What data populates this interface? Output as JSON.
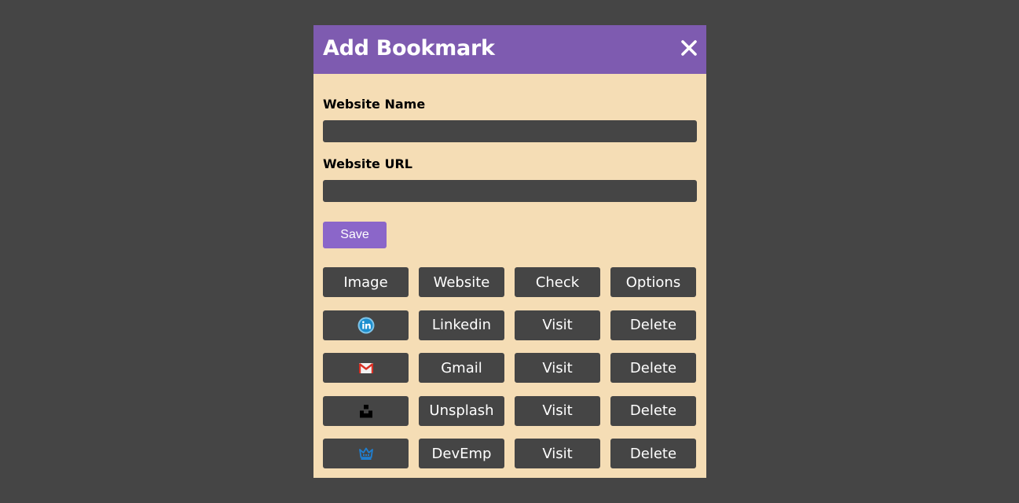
{
  "modal": {
    "title": "Add Bookmark",
    "close_icon": "close-icon"
  },
  "form": {
    "name_label": "Website Name",
    "name_value": "",
    "url_label": "Website URL",
    "url_value": "",
    "save_label": "Save"
  },
  "table": {
    "headers": [
      "Image",
      "Website",
      "Check",
      "Options"
    ],
    "rows": [
      {
        "icon": "linkedin-icon",
        "website": "Linkedin",
        "check": "Visit",
        "options": "Delete"
      },
      {
        "icon": "gmail-icon",
        "website": "Gmail",
        "check": "Visit",
        "options": "Delete"
      },
      {
        "icon": "unsplash-icon",
        "website": "Unsplash",
        "check": "Visit",
        "options": "Delete"
      },
      {
        "icon": "devemp-icon",
        "website": "DevEmp",
        "check": "Visit",
        "options": "Delete"
      }
    ]
  },
  "colors": {
    "page_background": "#454545",
    "modal_background": "#f5ddb5",
    "header_background": "#7e5bb0",
    "save_button": "#8b66c9",
    "cell_background": "#454545"
  }
}
